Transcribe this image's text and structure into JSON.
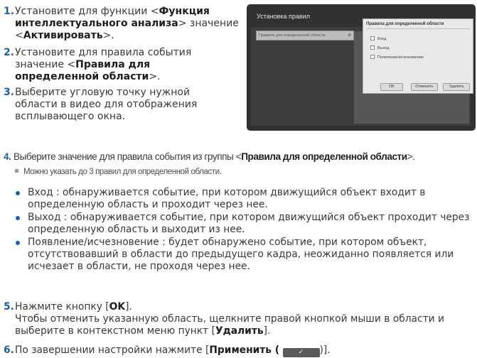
{
  "steps": {
    "s1": {
      "num": "1.",
      "t1": "Установите для функции <",
      "b1": "Функция интеллектуального анализа",
      "t2": "> значение <",
      "b2": "Активировать",
      "t3": ">."
    },
    "s2": {
      "num": "2.",
      "t1": "Установите для правила события значение <",
      "b1": "Правила для определенной области",
      "t2": ">."
    },
    "s3": {
      "num": "3.",
      "t1": "Выберите угловую точку нужной области в видео для отображения всплывающего окна."
    },
    "s4": {
      "num": "4.",
      "t1": "Выберите значение для правила события из группы <",
      "b1": "Правила для определенной области",
      "t2": ">."
    },
    "s5": {
      "num": "5.",
      "t1": "Нажмите кнопку [",
      "b1": "OK",
      "t2": "].",
      "t3": "Чтобы отменить указанную область, щелкните правой кнопкой мыши в области и выберите в контекстном меню пункт [",
      "b2": "Удалить",
      "t4": "]."
    },
    "s6": {
      "num": "6.",
      "t1": "По завершении настройки нажмите [",
      "b1": "Применить (",
      "t2": ")]."
    }
  },
  "note": "Можно указать до 3 правил для определенной области.",
  "bullets": [
    "Вход : обнаруживается событие, при котором движущийся объект входит в определенную область и проходит через нее.",
    "Выход : обнаруживается событие, при котором движущийся объект проходит через определенную область и выходит из нее.",
    "Появление/исчезновение : будет обнаружено событие, при котором объект, отсутствовавший в области до предыдущего кадра, неожиданно появляется или исчезает в области, не проходя через нее."
  ],
  "apply_icon_glyph": "✓",
  "screenshot": {
    "title": "Установка правил",
    "dropdown": "Правила для определенной области",
    "dropdown_clear": "⊗",
    "popup": {
      "title": "Правила для определенной области",
      "options": [
        "Вход",
        "Выход",
        "Появление/исчезновение"
      ],
      "ok": "OK",
      "cancel": "Отменить",
      "delete": "Удалить"
    }
  },
  "colors": {
    "accent": "#1d5fa8",
    "text": "#3a3a3a",
    "panel": "#313131"
  }
}
